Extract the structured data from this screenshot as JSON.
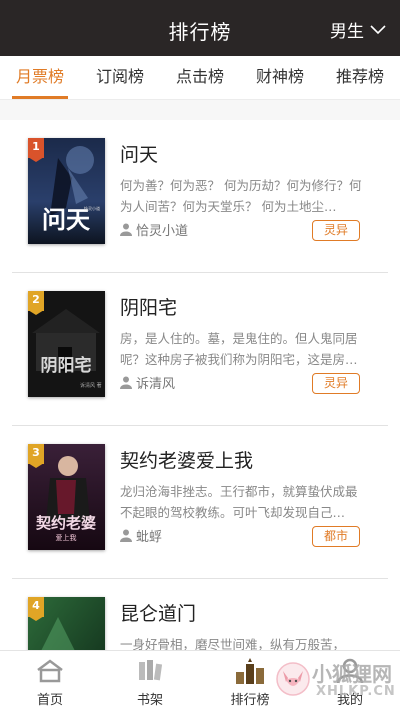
{
  "header": {
    "title": "排行榜",
    "gender": "男生",
    "gender_icon": "chevron-down-icon"
  },
  "tabs": [
    {
      "label": "月票榜",
      "active": true
    },
    {
      "label": "订阅榜",
      "active": false
    },
    {
      "label": "点击榜",
      "active": false
    },
    {
      "label": "财神榜",
      "active": false
    },
    {
      "label": "推荐榜",
      "active": false
    }
  ],
  "books": [
    {
      "rank": "1",
      "rank_color": "#d9532b",
      "title": "问天",
      "description": "何为善？何为恶？ 何为历劫？何为修行？何为人间苦？何为天堂乐？ 何为土地尘…",
      "author": "恰灵小道",
      "genre": "灵异",
      "cover_text": "问天",
      "cover_small": "恰灵小道"
    },
    {
      "rank": "2",
      "rank_color": "#e0a526",
      "title": "阴阳宅",
      "description": "房，是人住的。墓，是鬼住的。但人鬼同居呢？这种房子被我们称为阴阳宅，这是房…",
      "author": "诉清风",
      "genre": "灵异",
      "cover_text": "阴阳宅",
      "cover_small": "诉清风 著"
    },
    {
      "rank": "3",
      "rank_color": "#e0a526",
      "title": "契约老婆爱上我",
      "description": "龙归沧海非挫志。王行都市，就算蛰伏成最不起眼的驾校教练。可叶飞却发现自己…",
      "author": "蚍蜉",
      "genre": "都市",
      "cover_text": "契约老婆",
      "cover_small": "爱上我"
    },
    {
      "rank": "4",
      "rank_color": "#e0a526",
      "title": "昆仑道门",
      "description": "一身好骨相，磨尽世间难，纵有万般苦，心…",
      "author": "",
      "genre": "",
      "cover_text": "",
      "cover_small": ""
    }
  ],
  "bottom_nav": [
    {
      "label": "首页",
      "icon": "home-icon",
      "active": false
    },
    {
      "label": "书架",
      "icon": "bookshelf-icon",
      "active": false
    },
    {
      "label": "排行榜",
      "icon": "ranking-icon",
      "active": true
    },
    {
      "label": "我的",
      "icon": "profile-icon",
      "active": false
    }
  ],
  "watermark": {
    "text": "小狐狸网",
    "sub": "XHLKP.CN"
  },
  "colors": {
    "accent": "#e07b26",
    "header_bg": "#2a2626"
  }
}
